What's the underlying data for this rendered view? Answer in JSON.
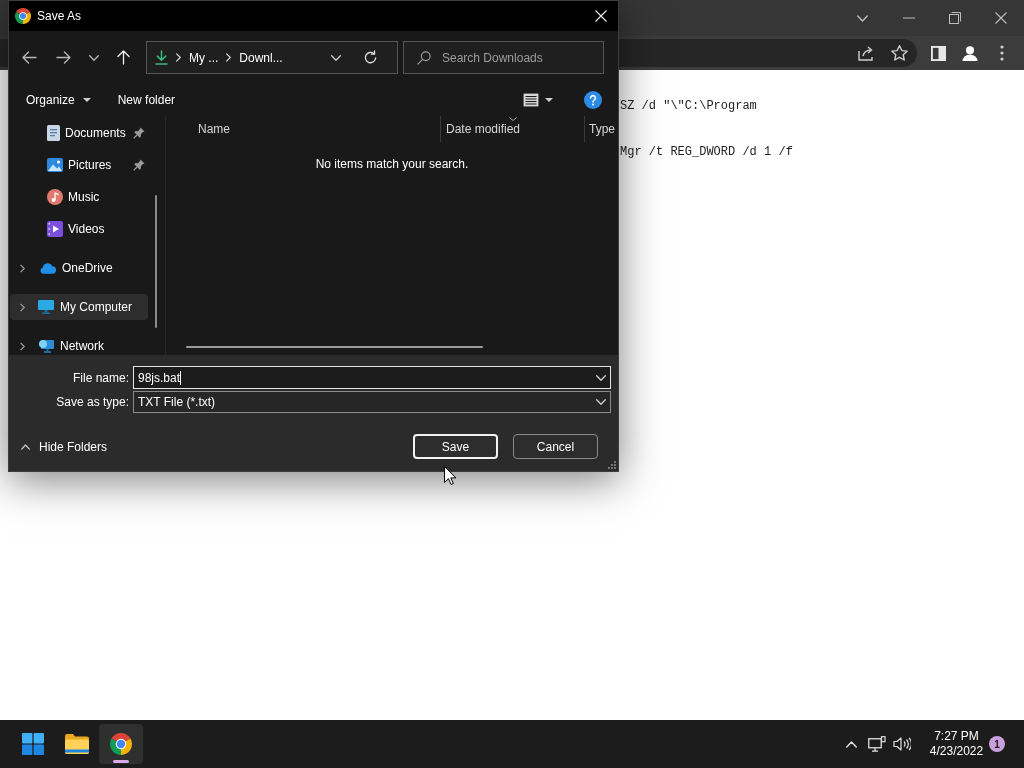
{
  "browser": {
    "page_lines": [
      "SZ /d \"\\\"C:\\Program",
      "Mgr /t REG_DWORD /d 1 /f"
    ]
  },
  "dialog": {
    "title": "Save As",
    "breadcrumb": [
      "My ...",
      "Downl..."
    ],
    "search": {
      "placeholder": "Search Downloads"
    },
    "toolbar": [
      {
        "label": "Organize",
        "kind": "menu"
      },
      {
        "label": "New folder",
        "kind": "button"
      }
    ],
    "sidebar": {
      "quick_access": [
        {
          "label": "Documents",
          "kind": "documents",
          "pinned": true,
          "selected": false
        },
        {
          "label": "Pictures",
          "kind": "pictures",
          "pinned": true,
          "selected": false
        },
        {
          "label": "Music",
          "kind": "music",
          "pinned": false,
          "selected": false
        },
        {
          "label": "Videos",
          "kind": "videos",
          "pinned": false,
          "selected": false
        }
      ],
      "locations": [
        {
          "label": "OneDrive",
          "kind": "cloud",
          "expanded": false,
          "selected": false
        },
        {
          "label": "My Computer",
          "kind": "computer",
          "expanded": false,
          "selected": true
        },
        {
          "label": "Network",
          "kind": "network",
          "expanded": false,
          "selected": false
        }
      ]
    },
    "columns": [
      {
        "label": "Name",
        "sorted": false
      },
      {
        "label": "Date modified",
        "sorted": true
      },
      {
        "label": "Type",
        "sorted": false
      }
    ],
    "empty_message": "No items match your search.",
    "file_name": {
      "label": "File name:",
      "value": "98js.bat",
      "focused": true
    },
    "save_as_type": {
      "label": "Save as type:",
      "value": "TXT File (*.txt)",
      "focused": false
    },
    "hide_folders": "Hide Folders",
    "buttons": [
      {
        "label": "Save",
        "default": true
      },
      {
        "label": "Cancel",
        "default": false
      }
    ]
  },
  "taskbar": {
    "apps": [
      {
        "kind": "start",
        "active": false
      },
      {
        "kind": "explorer",
        "active": false
      },
      {
        "kind": "chrome",
        "active": true
      }
    ],
    "time": "7:27 PM",
    "date": "4/23/2022",
    "notifications": "1"
  }
}
